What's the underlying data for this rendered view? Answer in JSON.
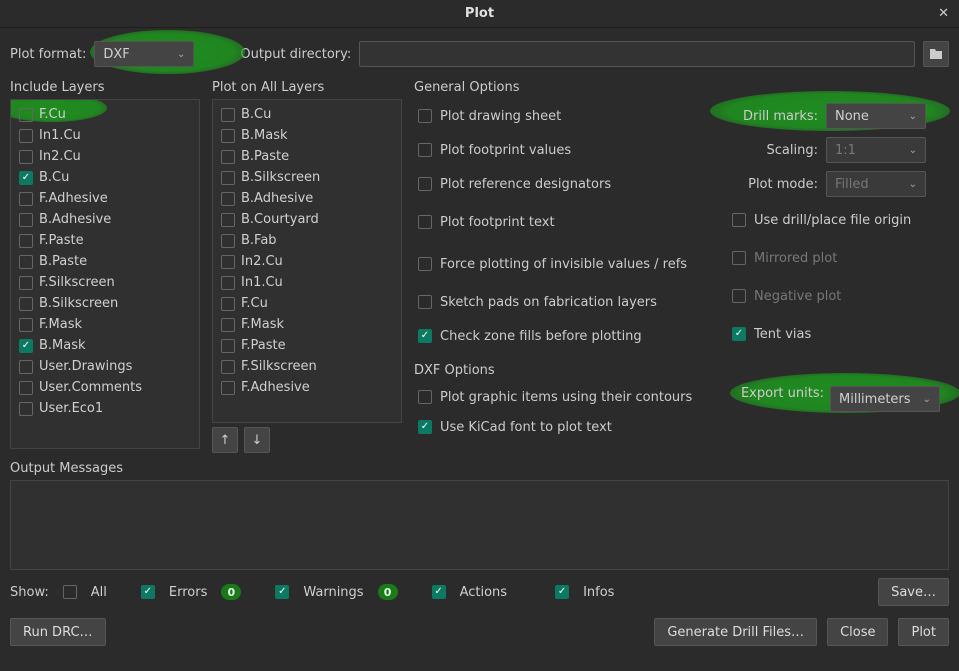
{
  "title": "Plot",
  "plotFormat": {
    "label": "Plot format:",
    "value": "DXF"
  },
  "outputDir": {
    "label": "Output directory:",
    "value": ""
  },
  "includeLayers": {
    "label": "Include Layers",
    "items": [
      {
        "name": "F.Cu",
        "checked": false
      },
      {
        "name": "In1.Cu",
        "checked": false
      },
      {
        "name": "In2.Cu",
        "checked": false
      },
      {
        "name": "B.Cu",
        "checked": true
      },
      {
        "name": "F.Adhesive",
        "checked": false
      },
      {
        "name": "B.Adhesive",
        "checked": false
      },
      {
        "name": "F.Paste",
        "checked": false
      },
      {
        "name": "B.Paste",
        "checked": false
      },
      {
        "name": "F.Silkscreen",
        "checked": false
      },
      {
        "name": "B.Silkscreen",
        "checked": false
      },
      {
        "name": "F.Mask",
        "checked": false
      },
      {
        "name": "B.Mask",
        "checked": true
      },
      {
        "name": "User.Drawings",
        "checked": false
      },
      {
        "name": "User.Comments",
        "checked": false
      },
      {
        "name": "User.Eco1",
        "checked": false
      }
    ]
  },
  "plotAllLayers": {
    "label": "Plot on All Layers",
    "items": [
      {
        "name": "B.Cu",
        "checked": false
      },
      {
        "name": "B.Mask",
        "checked": false
      },
      {
        "name": "B.Paste",
        "checked": false
      },
      {
        "name": "B.Silkscreen",
        "checked": false
      },
      {
        "name": "B.Adhesive",
        "checked": false
      },
      {
        "name": "B.Courtyard",
        "checked": false
      },
      {
        "name": "B.Fab",
        "checked": false
      },
      {
        "name": "In2.Cu",
        "checked": false
      },
      {
        "name": "In1.Cu",
        "checked": false
      },
      {
        "name": "F.Cu",
        "checked": false
      },
      {
        "name": "F.Mask",
        "checked": false
      },
      {
        "name": "F.Paste",
        "checked": false
      },
      {
        "name": "F.Silkscreen",
        "checked": false
      },
      {
        "name": "F.Adhesive",
        "checked": false
      }
    ]
  },
  "generalOptions": {
    "label": "General Options",
    "leftChecks": [
      {
        "key": "plot_drawing_sheet",
        "label": "Plot drawing sheet",
        "checked": false
      },
      {
        "key": "plot_footprint_values",
        "label": "Plot footprint values",
        "checked": false
      },
      {
        "key": "plot_reference_designators",
        "label": "Plot reference designators",
        "checked": false
      },
      {
        "key": "plot_footprint_text",
        "label": "Plot footprint text",
        "checked": false
      },
      {
        "key": "force_invisible",
        "label": "Force plotting of invisible values / refs",
        "checked": false
      },
      {
        "key": "sketch_pads",
        "label": "Sketch pads on fabrication layers",
        "checked": false
      },
      {
        "key": "check_zone_fills",
        "label": "Check zone fills before plotting",
        "checked": true
      }
    ],
    "rightForm": {
      "drillMarks": {
        "label": "Drill marks:",
        "value": "None"
      },
      "scaling": {
        "label": "Scaling:",
        "value": "1:1"
      },
      "plotMode": {
        "label": "Plot mode:",
        "value": "Filled"
      }
    },
    "rightChecks": [
      {
        "key": "use_drill_origin",
        "label": "Use drill/place file origin",
        "checked": false,
        "disabled": false
      },
      {
        "key": "mirrored",
        "label": "Mirrored plot",
        "checked": false,
        "disabled": true
      },
      {
        "key": "negative",
        "label": "Negative plot",
        "checked": false,
        "disabled": true
      },
      {
        "key": "tent_vias",
        "label": "Tent vias",
        "checked": true,
        "disabled": false
      }
    ]
  },
  "dxfOptions": {
    "label": "DXF Options",
    "checks": [
      {
        "key": "plot_graphic_contours",
        "label": "Plot graphic items using their contours",
        "checked": false
      },
      {
        "key": "use_kicad_font",
        "label": "Use KiCad font to plot text",
        "checked": true
      }
    ],
    "exportUnits": {
      "label": "Export units:",
      "value": "Millimeters"
    }
  },
  "outputMessages": {
    "label": "Output Messages"
  },
  "showRow": {
    "label": "Show:",
    "all": "All",
    "errors": {
      "label": "Errors",
      "count": "0"
    },
    "warnings": {
      "label": "Warnings",
      "count": "0"
    },
    "actions": "Actions",
    "infos": "Infos",
    "save": "Save…"
  },
  "footer": {
    "runDrc": "Run DRC…",
    "genDrill": "Generate Drill Files…",
    "close": "Close",
    "plot": "Plot"
  }
}
